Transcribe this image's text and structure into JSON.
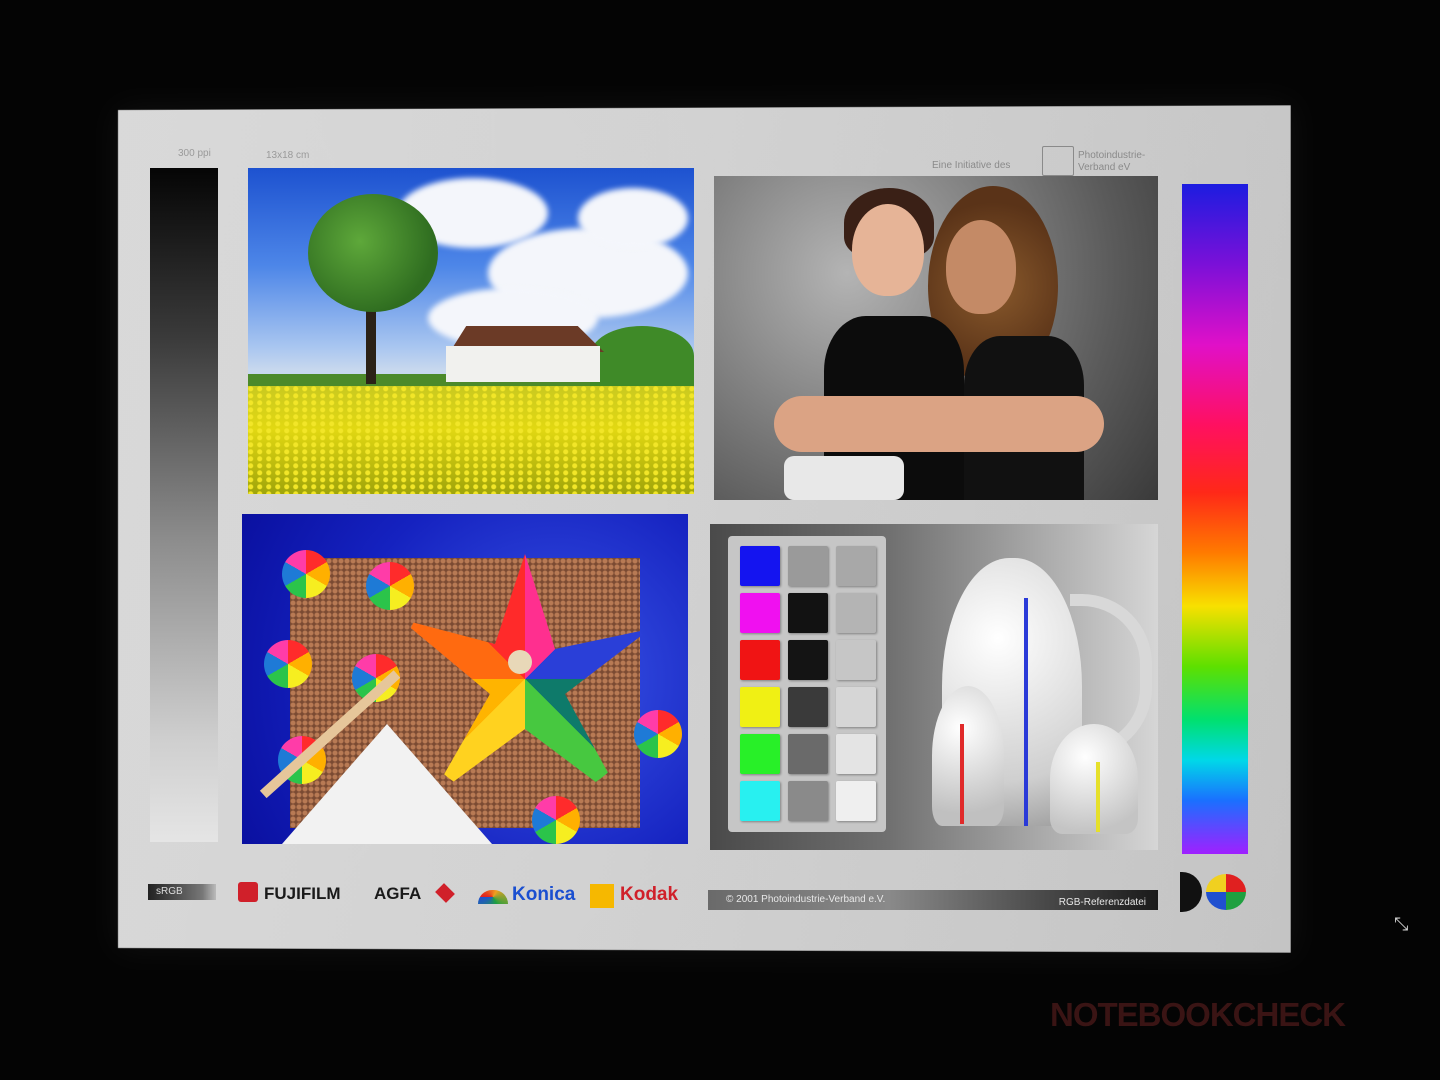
{
  "header": {
    "resolution": "300 ppi",
    "size": "13x18 cm",
    "initiative": "Eine Initiative des",
    "org_line1": "Photoindustrie-",
    "org_line2": "Verband eV"
  },
  "footer": {
    "profile": "sRGB",
    "brands": [
      "FUJIFILM",
      "AGFA",
      "Konica",
      "Kodak"
    ],
    "copyright": "© 2001  Photoindustrie-Verband e.V.",
    "reference": "RGB-Referenzdatei",
    "dq_logo": "DQ"
  },
  "watermark": "NOTEBOOKCHECK",
  "colors": {
    "checker_chips": [
      "#1414f0",
      "#f010f0",
      "#f01414",
      "#f0f014",
      "#28f028",
      "#28f0f0"
    ],
    "gray_chips_mid": [
      "#9a9a9a",
      "#121212",
      "#141414",
      "#3a3a3a",
      "#6a6a6a",
      "#8a8a8a"
    ],
    "gray_chips_right": [
      "#a8a8a8",
      "#b4b4b4",
      "#c6c6c6",
      "#d6d6d6",
      "#e4e4e4",
      "#efefef"
    ]
  },
  "icons": [
    "expand-icon"
  ]
}
